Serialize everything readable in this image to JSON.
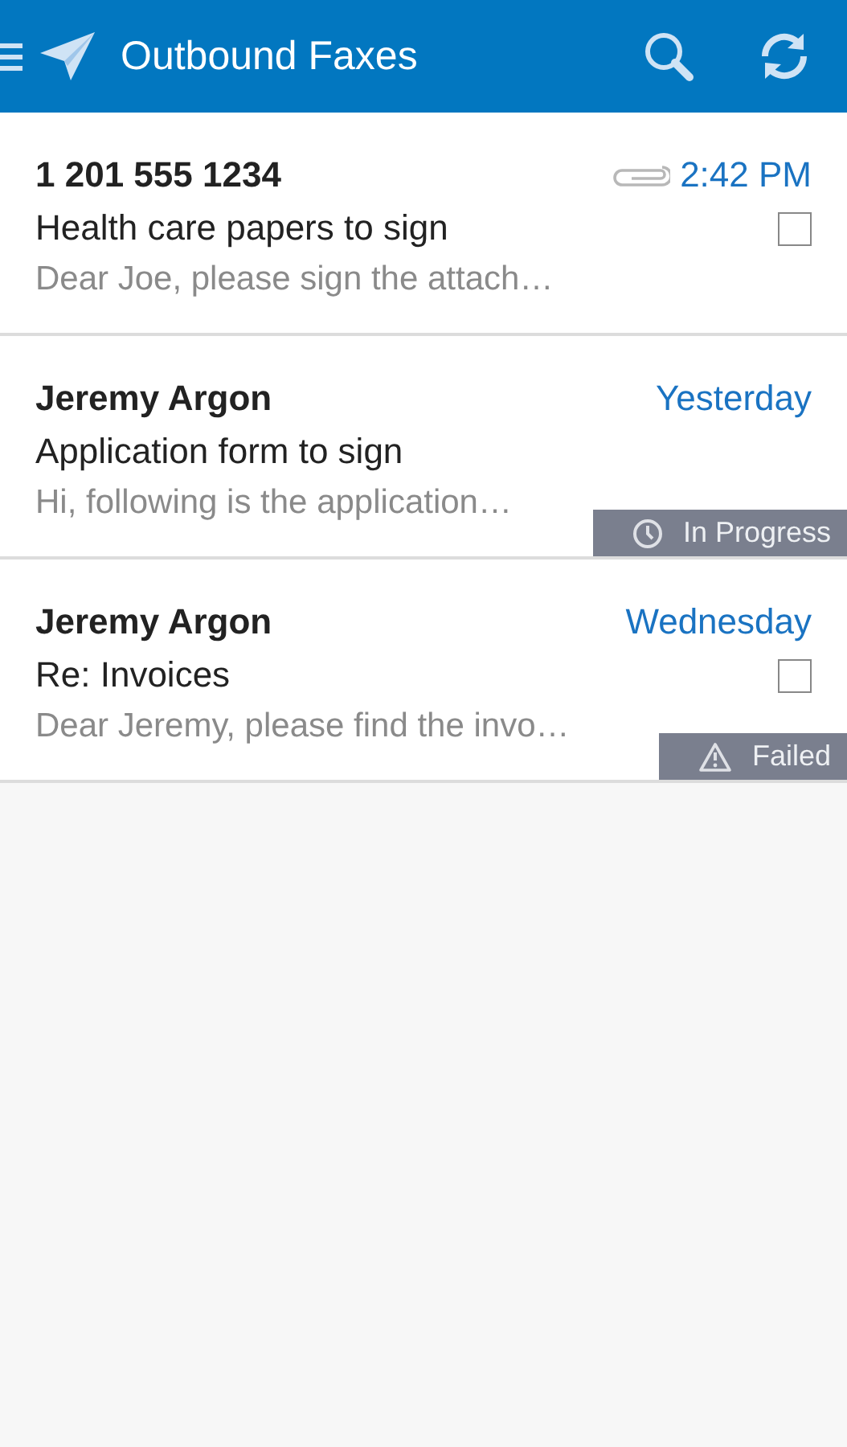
{
  "app_bar": {
    "title": "Outbound Faxes"
  },
  "faxes": [
    {
      "recipient": "1 201 555 1234",
      "time": "2:42 PM",
      "subject": "Health care papers to sign",
      "preview": "Dear Joe, please sign the attach…",
      "attachment": true,
      "checkbox": {
        "checked": false
      }
    },
    {
      "recipient": "Jeremy Argon",
      "time": "Yesterday",
      "subject": "Application form to sign",
      "preview": "Hi, following is the application…",
      "attachment": false,
      "status": {
        "kind": "progress",
        "label": "In Progress"
      }
    },
    {
      "recipient": "Jeremy Argon",
      "time": "Wednesday",
      "subject": "Re: Invoices",
      "preview": "Dear Jeremy, please find the invo…",
      "attachment": false,
      "checkbox": {
        "checked": false
      },
      "status": {
        "kind": "failed",
        "label": "Failed"
      }
    }
  ]
}
